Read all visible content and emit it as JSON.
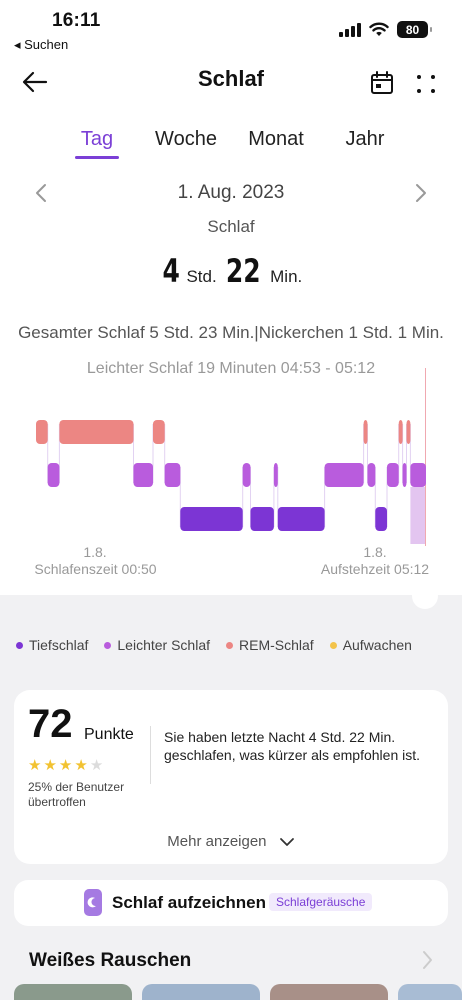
{
  "status": {
    "time": "16:11",
    "back": "◂ Suchen",
    "battery": "80"
  },
  "header": {
    "title": "Schlaf"
  },
  "tabs": [
    {
      "label": "Tag",
      "active": true
    },
    {
      "label": "Woche",
      "active": false
    },
    {
      "label": "Monat",
      "active": false
    },
    {
      "label": "Jahr",
      "active": false
    }
  ],
  "date": "1. Aug. 2023",
  "section_label": "Schlaf",
  "duration": {
    "hours": "4",
    "hours_unit": "Std.",
    "minutes": "22",
    "minutes_unit": "Min."
  },
  "summary": "Gesamter Schlaf 5 Std. 23 Min.|Nickerchen 1 Std. 1 Min.",
  "selected_detail": "Leichter Schlaf 19 Minuten 04:53 - 05:12",
  "chart_axis": {
    "start_date": "1.8.",
    "start_label": "Schlafenszeit 00:50",
    "end_date": "1.8.",
    "end_label": "Aufstehzeit 05:12"
  },
  "colors": {
    "deep": "#7c35d4",
    "light": "#b95cdd",
    "rem": "#ec8683",
    "awake": "#f3c34a",
    "accent": "#7b3fd6"
  },
  "chart_data": {
    "type": "bar",
    "title": "",
    "stages": [
      "REM-Schlaf",
      "Leichter Schlaf",
      "Tiefschlaf"
    ],
    "segments": [
      {
        "stage": "REM-Schlaf",
        "start": 0.0,
        "end": 0.03
      },
      {
        "stage": "Leichter Schlaf",
        "start": 0.03,
        "end": 0.06
      },
      {
        "stage": "REM-Schlaf",
        "start": 0.06,
        "end": 0.25
      },
      {
        "stage": "Leichter Schlaf",
        "start": 0.25,
        "end": 0.3
      },
      {
        "stage": "REM-Schlaf",
        "start": 0.3,
        "end": 0.33
      },
      {
        "stage": "Leichter Schlaf",
        "start": 0.33,
        "end": 0.37
      },
      {
        "stage": "Tiefschlaf",
        "start": 0.37,
        "end": 0.53
      },
      {
        "stage": "Leichter Schlaf",
        "start": 0.53,
        "end": 0.55
      },
      {
        "stage": "Tiefschlaf",
        "start": 0.55,
        "end": 0.61
      },
      {
        "stage": "Leichter Schlaf",
        "start": 0.61,
        "end": 0.62
      },
      {
        "stage": "Tiefschlaf",
        "start": 0.62,
        "end": 0.74
      },
      {
        "stage": "Leichter Schlaf",
        "start": 0.74,
        "end": 0.84
      },
      {
        "stage": "REM-Schlaf",
        "start": 0.84,
        "end": 0.85
      },
      {
        "stage": "Leichter Schlaf",
        "start": 0.85,
        "end": 0.87
      },
      {
        "stage": "Tiefschlaf",
        "start": 0.87,
        "end": 0.9
      },
      {
        "stage": "Leichter Schlaf",
        "start": 0.9,
        "end": 0.93
      },
      {
        "stage": "REM-Schlaf",
        "start": 0.93,
        "end": 0.94
      },
      {
        "stage": "Leichter Schlaf",
        "start": 0.94,
        "end": 0.95
      },
      {
        "stage": "REM-Schlaf",
        "start": 0.95,
        "end": 0.96
      },
      {
        "stage": "Leichter Schlaf",
        "start": 0.96,
        "end": 1.0
      }
    ],
    "selected_segment": 19
  },
  "legend": [
    {
      "label": "Tiefschlaf",
      "color": "#7c35d4"
    },
    {
      "label": "Leichter Schlaf",
      "color": "#b95cdd"
    },
    {
      "label": "REM-Schlaf",
      "color": "#ec8683"
    },
    {
      "label": "Aufwachen",
      "color": "#f3c34a"
    }
  ],
  "score": {
    "value": "72",
    "unit": "Punkte",
    "stars": 4,
    "max_stars": 5,
    "subtext": "25% der Benutzer übertroffen",
    "description": "Sie haben letzte Nacht 4 Std. 22 Min. geschlafen, was kürzer als empfohlen ist.",
    "more": "Mehr anzeigen"
  },
  "record": {
    "label": "Schlaf aufzeichnen",
    "badge": "Schlafgeräusche"
  },
  "noise": {
    "title": "Weißes Rauschen"
  }
}
